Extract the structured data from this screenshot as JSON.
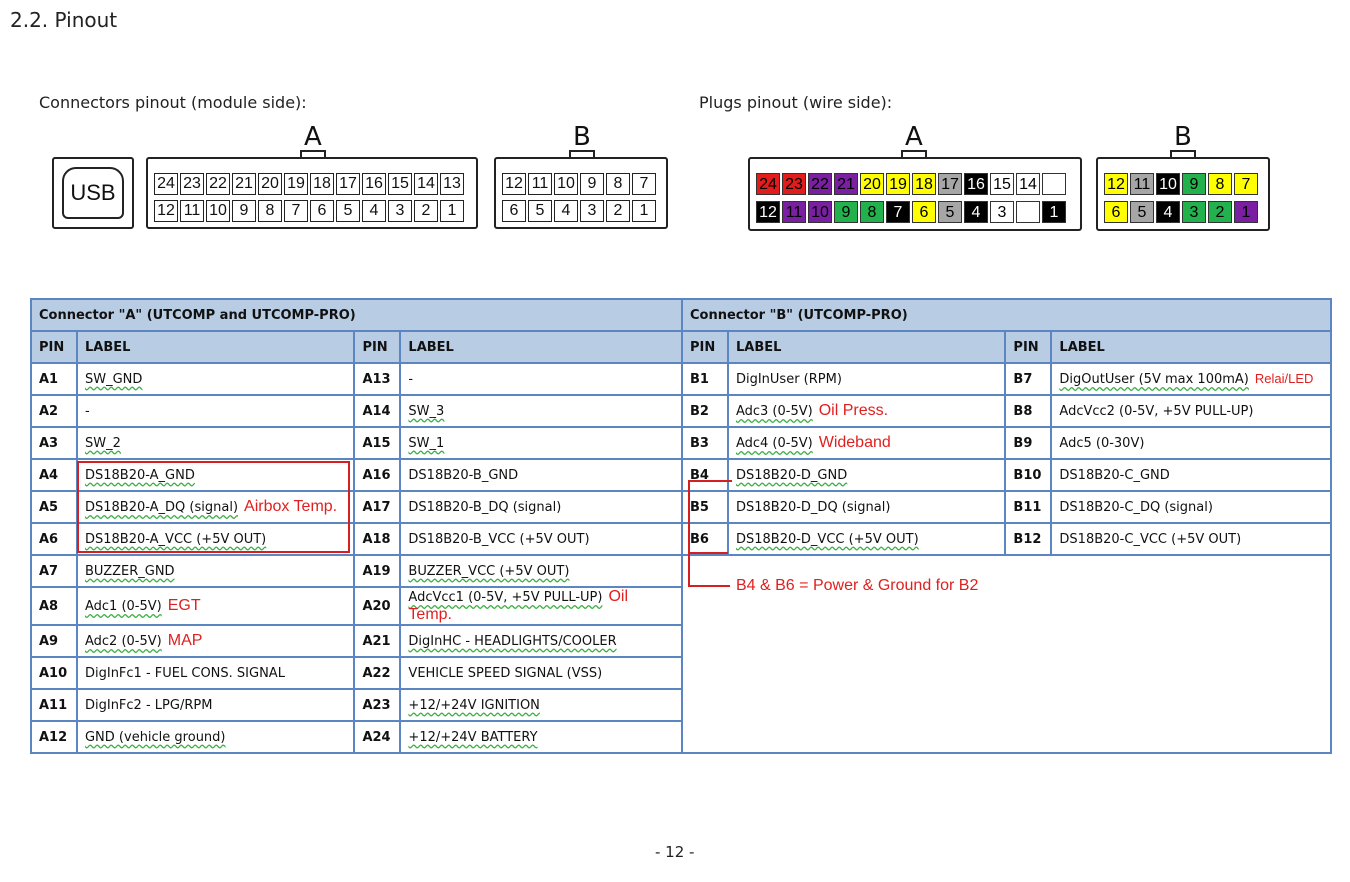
{
  "section_title": "2.2. Pinout",
  "captions": {
    "left": "Connectors pinout (module side):",
    "right": "Plugs pinout (wire side):"
  },
  "usb_label": "USB",
  "connector_letters": {
    "a": "A",
    "b": "B"
  },
  "module_a": {
    "top": [
      "24",
      "23",
      "22",
      "21",
      "20",
      "19",
      "18",
      "17",
      "16",
      "15",
      "14",
      "13"
    ],
    "bottom": [
      "12",
      "11",
      "10",
      "9",
      "8",
      "7",
      "6",
      "5",
      "4",
      "3",
      "2",
      "1"
    ]
  },
  "module_b": {
    "top": [
      "12",
      "11",
      "10",
      "9",
      "8",
      "7"
    ],
    "bottom": [
      "6",
      "5",
      "4",
      "3",
      "2",
      "1"
    ]
  },
  "plug_a": {
    "top": [
      {
        "n": "24",
        "bg": "#e31b1b",
        "fg": "#000000"
      },
      {
        "n": "23",
        "bg": "#e31b1b",
        "fg": "#000000"
      },
      {
        "n": "22",
        "bg": "#7b1fa2",
        "fg": "#000000"
      },
      {
        "n": "21",
        "bg": "#7b1fa2",
        "fg": "#000000"
      },
      {
        "n": "20",
        "bg": "#ffff00",
        "fg": "#000000"
      },
      {
        "n": "19",
        "bg": "#ffff00",
        "fg": "#000000"
      },
      {
        "n": "18",
        "bg": "#ffff00",
        "fg": "#000000"
      },
      {
        "n": "17",
        "bg": "#a6a6a6",
        "fg": "#000000"
      },
      {
        "n": "16",
        "bg": "#000000",
        "fg": "#ffffff"
      },
      {
        "n": "15",
        "bg": "#ffffff",
        "fg": "#000000"
      },
      {
        "n": "14",
        "bg": "#ffffff",
        "fg": "#000000"
      },
      {
        "n": "",
        "bg": "#ffffff",
        "fg": "#000000"
      }
    ],
    "bottom": [
      {
        "n": "12",
        "bg": "#000000",
        "fg": "#ffffff"
      },
      {
        "n": "11",
        "bg": "#7b1fa2",
        "fg": "#000000"
      },
      {
        "n": "10",
        "bg": "#7b1fa2",
        "fg": "#000000"
      },
      {
        "n": "9",
        "bg": "#22b14c",
        "fg": "#000000"
      },
      {
        "n": "8",
        "bg": "#22b14c",
        "fg": "#000000"
      },
      {
        "n": "7",
        "bg": "#000000",
        "fg": "#ffffff"
      },
      {
        "n": "6",
        "bg": "#ffff00",
        "fg": "#000000"
      },
      {
        "n": "5",
        "bg": "#a6a6a6",
        "fg": "#000000"
      },
      {
        "n": "4",
        "bg": "#000000",
        "fg": "#ffffff"
      },
      {
        "n": "3",
        "bg": "#ffffff",
        "fg": "#000000"
      },
      {
        "n": "",
        "bg": "#ffffff",
        "fg": "#000000"
      },
      {
        "n": "1",
        "bg": "#000000",
        "fg": "#ffffff"
      }
    ]
  },
  "plug_b": {
    "top": [
      {
        "n": "12",
        "bg": "#ffff00",
        "fg": "#000000"
      },
      {
        "n": "11",
        "bg": "#a6a6a6",
        "fg": "#000000"
      },
      {
        "n": "10",
        "bg": "#000000",
        "fg": "#ffffff"
      },
      {
        "n": "9",
        "bg": "#22b14c",
        "fg": "#000000"
      },
      {
        "n": "8",
        "bg": "#ffff00",
        "fg": "#000000"
      },
      {
        "n": "7",
        "bg": "#ffff00",
        "fg": "#000000"
      }
    ],
    "bottom": [
      {
        "n": "6",
        "bg": "#ffff00",
        "fg": "#000000"
      },
      {
        "n": "5",
        "bg": "#a6a6a6",
        "fg": "#000000"
      },
      {
        "n": "4",
        "bg": "#000000",
        "fg": "#ffffff"
      },
      {
        "n": "3",
        "bg": "#22b14c",
        "fg": "#000000"
      },
      {
        "n": "2",
        "bg": "#22b14c",
        "fg": "#000000"
      },
      {
        "n": "1",
        "bg": "#7b1fa2",
        "fg": "#000000"
      }
    ]
  },
  "table": {
    "header_a": "Connector \"A\" (UTCOMP and UTCOMP-PRO)",
    "header_b": "Connector \"B\" (UTCOMP-PRO)",
    "col_pin": "PIN",
    "col_label": "LABEL",
    "rows": [
      {
        "a1": "A1",
        "l1": "SW_GND",
        "g1": true,
        "n1": "",
        "a2": "A13",
        "l2": "-",
        "g2": false,
        "n2": "",
        "b1": "B1",
        "bl1": "DigInUser (RPM)",
        "bg1": false,
        "bn1": "",
        "b2": "B7",
        "bl2": "DigOutUser (5V max 100mA)",
        "bg2": true,
        "bn2": "Relai/LED"
      },
      {
        "a1": "A2",
        "l1": "-",
        "g1": false,
        "n1": "",
        "a2": "A14",
        "l2": "SW_3",
        "g2": true,
        "n2": "",
        "b1": "B2",
        "bl1": "Adc3 (0-5V)",
        "bg1": true,
        "bn1": "Oil Press.",
        "b2": "B8",
        "bl2": "AdcVcc2 (0-5V, +5V PULL-UP)",
        "bg2": false,
        "bn2": ""
      },
      {
        "a1": "A3",
        "l1": "SW_2",
        "g1": true,
        "n1": "",
        "a2": "A15",
        "l2": "SW_1",
        "g2": true,
        "n2": "",
        "b1": "B3",
        "bl1": "Adc4 (0-5V)",
        "bg1": true,
        "bn1": "Wideband",
        "b2": "B9",
        "bl2": "Adc5 (0-30V)",
        "bg2": false,
        "bn2": ""
      },
      {
        "a1": "A4",
        "l1": "DS18B20-A_GND",
        "g1": true,
        "n1": "",
        "a2": "A16",
        "l2": "DS18B20-B_GND",
        "g2": false,
        "n2": "",
        "b1": "B4",
        "bl1": "DS18B20-D_GND",
        "bg1": true,
        "bn1": "",
        "b2": "B10",
        "bl2": "DS18B20-C_GND",
        "bg2": false,
        "bn2": ""
      },
      {
        "a1": "A5",
        "l1": "DS18B20-A_DQ (signal)",
        "g1": true,
        "n1": "Airbox Temp.",
        "a2": "A17",
        "l2": "DS18B20-B_DQ (signal)",
        "g2": false,
        "n2": "",
        "b1": "B5",
        "bl1": "DS18B20-D_DQ (signal)",
        "bg1": false,
        "bn1": "",
        "b2": "B11",
        "bl2": "DS18B20-C_DQ (signal)",
        "bg2": false,
        "bn2": ""
      },
      {
        "a1": "A6",
        "l1": "DS18B20-A_VCC (+5V OUT)",
        "g1": true,
        "n1": "",
        "a2": "A18",
        "l2": "DS18B20-B_VCC (+5V OUT)",
        "g2": false,
        "n2": "",
        "b1": "B6",
        "bl1": "DS18B20-D_VCC (+5V OUT)",
        "bg1": true,
        "bn1": "",
        "b2": "B12",
        "bl2": "DS18B20-C_VCC (+5V OUT)",
        "bg2": false,
        "bn2": ""
      },
      {
        "a1": "A7",
        "l1": "BUZZER_GND",
        "g1": true,
        "n1": "",
        "a2": "A19",
        "l2": "BUZZER_VCC (+5V OUT)",
        "g2": true,
        "n2": ""
      },
      {
        "a1": "A8",
        "l1": "Adc1 (0-5V)",
        "g1": true,
        "n1": "EGT",
        "a2": "A20",
        "l2": "AdcVcc1 (0-5V, +5V PULL-UP)",
        "g2": true,
        "n2": "Oil Temp."
      },
      {
        "a1": "A9",
        "l1": "Adc2 (0-5V)",
        "g1": true,
        "n1": "MAP",
        "a2": "A21",
        "l2": "DigInHC - HEADLIGHTS/COOLER",
        "g2": true,
        "n2": ""
      },
      {
        "a1": "A10",
        "l1": "DigInFc1 - FUEL CONS. SIGNAL",
        "g1": false,
        "n1": "",
        "a2": "A22",
        "l2": "VEHICLE SPEED SIGNAL (VSS)",
        "g2": false,
        "n2": ""
      },
      {
        "a1": "A11",
        "l1": "DigInFc2 - LPG/RPM",
        "g1": false,
        "n1": "",
        "a2": "A23",
        "l2": "+12/+24V IGNITION",
        "g2": true,
        "n2": ""
      },
      {
        "a1": "A12",
        "l1": "GND (vehicle ground)",
        "g1": true,
        "n1": "",
        "a2": "A24",
        "l2": "+12/+24V BATTERY",
        "g2": true,
        "n2": ""
      }
    ],
    "b_note": "B4 & B6 = Power & Ground for B2"
  },
  "page_number": "- 12 -",
  "colors": {
    "table_border": "#5b86c1",
    "header_bg": "#b8cce4",
    "annotation_red": "#e02020"
  }
}
